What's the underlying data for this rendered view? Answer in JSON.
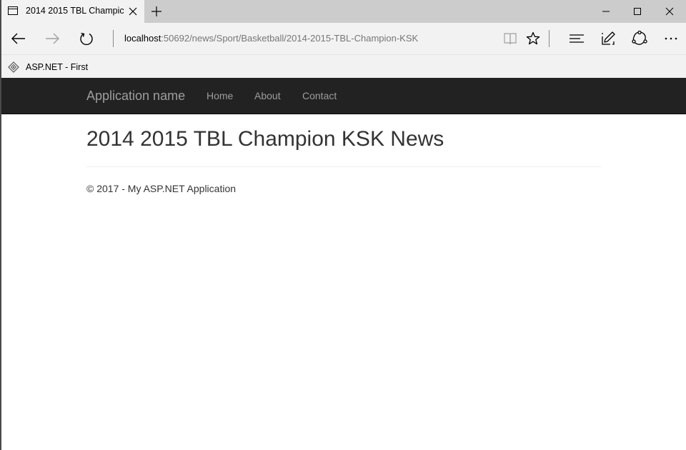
{
  "browser": {
    "tab": {
      "title": "2014 2015 TBL Champic"
    },
    "address": {
      "host": "localhost",
      "path": ":50692/news/Sport/Basketball/2014-2015-TBL-Champion-KSK"
    },
    "favorites": [
      {
        "label": "ASP.NET - First"
      }
    ]
  },
  "site": {
    "brand": "Application name",
    "nav": [
      {
        "label": "Home"
      },
      {
        "label": "About"
      },
      {
        "label": "Contact"
      }
    ]
  },
  "page": {
    "title": "2014 2015 TBL Champion KSK News",
    "footer": "© 2017 - My ASP.NET Application"
  },
  "colors": {
    "navbar_bg": "#222222",
    "navbar_text": "#9d9d9d",
    "chrome_bg": "#f2f2f2",
    "tabstrip_bg": "#cccccc"
  },
  "icons": {
    "tab": "tab-page-icon",
    "close": "close-icon",
    "new_tab": "plus-icon",
    "back": "back-arrow-icon",
    "forward": "forward-arrow-icon",
    "refresh": "refresh-icon",
    "reading_view": "book-icon",
    "favorite": "star-icon",
    "hub": "hub-icon",
    "notes": "pen-icon",
    "share": "share-icon",
    "more": "more-icon"
  }
}
